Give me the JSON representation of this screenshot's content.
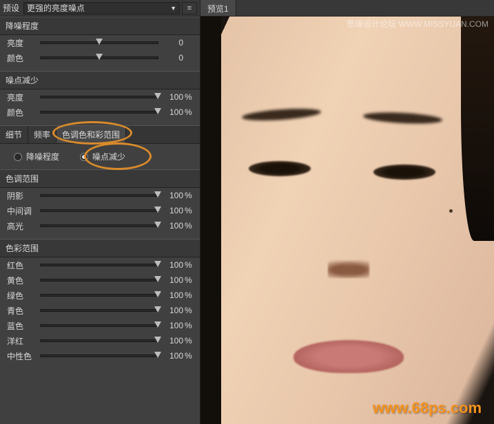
{
  "preset": {
    "label": "预设",
    "value": "更强的亮度噪点"
  },
  "sections": {
    "denoise": {
      "title": "降噪程度",
      "brightness_label": "亮度",
      "brightness_value": "0",
      "color_label": "颜色",
      "color_value": "0"
    },
    "noise_reduce": {
      "title": "噪点减少",
      "brightness_label": "亮度",
      "brightness_value": "100",
      "brightness_unit": "%",
      "color_label": "颜色",
      "color_value": "100",
      "color_unit": "%"
    }
  },
  "tabs": {
    "detail": "细节",
    "frequency": "频率",
    "tonal_color_range": "色调色和彩范围"
  },
  "radios": {
    "denoise_level": "降噪程度",
    "noise_reduce": "噪点减少"
  },
  "tonal_range": {
    "title": "色调范围",
    "rows": [
      {
        "label": "阴影",
        "value": "100",
        "unit": "%"
      },
      {
        "label": "中间调",
        "value": "100",
        "unit": "%"
      },
      {
        "label": "高光",
        "value": "100",
        "unit": "%"
      }
    ]
  },
  "color_range": {
    "title": "色彩范围",
    "rows": [
      {
        "label": "红色",
        "value": "100",
        "unit": "%"
      },
      {
        "label": "黄色",
        "value": "100",
        "unit": "%"
      },
      {
        "label": "绿色",
        "value": "100",
        "unit": "%"
      },
      {
        "label": "青色",
        "value": "100",
        "unit": "%"
      },
      {
        "label": "蓝色",
        "value": "100",
        "unit": "%"
      },
      {
        "label": "洋红",
        "value": "100",
        "unit": "%"
      },
      {
        "label": "中性色",
        "value": "100",
        "unit": "%"
      }
    ]
  },
  "preview": {
    "tab": "预览1"
  },
  "watermarks": {
    "top": "思缘设计论坛  WWW.MISSYUAN.COM",
    "bottom": "www.68ps.com"
  }
}
